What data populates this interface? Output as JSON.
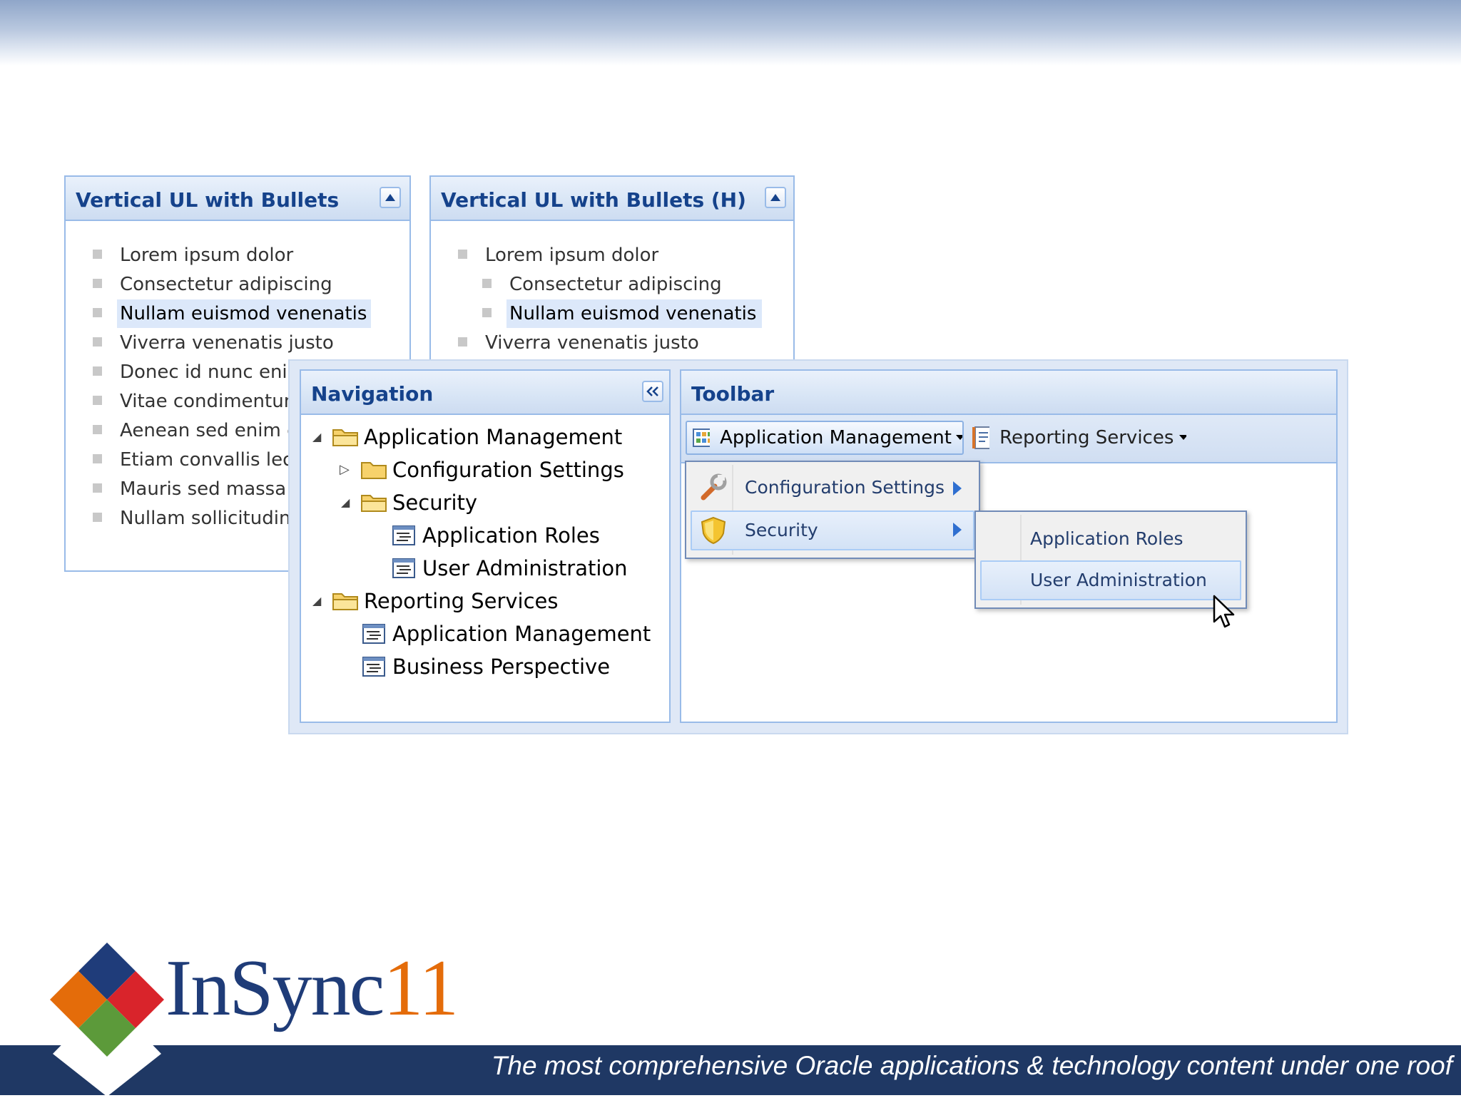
{
  "panel1": {
    "title": "Vertical UL with Bullets",
    "items": [
      "Lorem ipsum dolor",
      "Consectetur adipiscing",
      "Nullam euismod venenatis",
      "Viverra venenatis justo",
      "Donec id nunc enim",
      "Vitae condimentum",
      "Aenean sed enim eg",
      "Etiam convallis leo",
      "Mauris sed massa n",
      "Nullam sollicitudin"
    ],
    "highlighted_index": 2
  },
  "panel2": {
    "title": "Vertical UL with Bullets (H)",
    "items": [
      "Lorem ipsum dolor",
      "Consectetur adipiscing",
      "Nullam euismod venenatis",
      "Viverra venenatis justo"
    ],
    "highlighted_index": 2
  },
  "navigation": {
    "title": "Navigation",
    "collapse_icon": "double-chevron-left-icon",
    "tree": [
      {
        "label": "Application Management",
        "type": "folder",
        "expanded": true,
        "level": 0
      },
      {
        "label": "Configuration Settings",
        "type": "folder",
        "expanded": false,
        "level": 1
      },
      {
        "label": "Security",
        "type": "folder",
        "expanded": true,
        "level": 1
      },
      {
        "label": "Application Roles",
        "type": "leaf",
        "level": 2
      },
      {
        "label": "User Administration",
        "type": "leaf",
        "level": 2
      },
      {
        "label": "Reporting Services",
        "type": "folder",
        "expanded": true,
        "level": 0
      },
      {
        "label": "Application Management",
        "type": "leaf",
        "level": 1
      },
      {
        "label": "Business Perspective",
        "type": "leaf",
        "level": 1
      }
    ]
  },
  "toolbar": {
    "title": "Toolbar",
    "buttons": [
      {
        "label": "Application Management",
        "icon": "grid-icon",
        "pressed": true
      },
      {
        "label": "Reporting Services",
        "icon": "report-icon",
        "pressed": false
      }
    ],
    "menu": [
      {
        "label": "Configuration Settings",
        "icon": "wrench-icon",
        "has_submenu": true
      },
      {
        "label": "Security",
        "icon": "shield-icon",
        "has_submenu": true,
        "active": true
      }
    ],
    "submenu": [
      {
        "label": "Application Roles"
      },
      {
        "label": "User Administration",
        "active": true
      }
    ]
  },
  "branding": {
    "logo_main": "InSync",
    "logo_accent": "11",
    "tagline": "The most comprehensive Oracle applications & technology content under one roof"
  },
  "colors": {
    "header_text": "#15428b",
    "panel_border": "#99bbe8",
    "footer": "#1f3864",
    "logo_accent": "#e46c0a"
  }
}
